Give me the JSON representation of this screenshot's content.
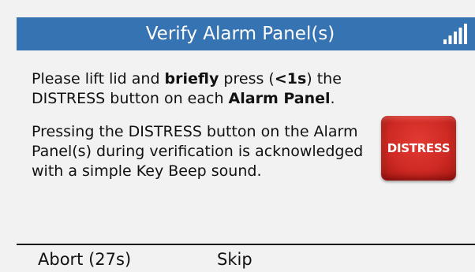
{
  "header": {
    "title": "Verify Alarm Panel(s)",
    "signal_icon": "signal-strength-icon",
    "background_color": "#3673b2"
  },
  "message": {
    "paragraph1": {
      "part1": "Please lift lid and ",
      "part2_bold": "briefly",
      "part3": " press (",
      "part4_bold": "<1s",
      "part5": ") the DISTRESS button on each ",
      "part6_bold": "Alarm Panel",
      "part7": "."
    },
    "paragraph2": "Pressing the DISTRESS button on the Alarm Panel(s) during verification is acknowledged with a simple Key Beep sound."
  },
  "distress_button": {
    "label": "DISTRESS",
    "color": "#cf2a24"
  },
  "softkeys": {
    "abort_label": "Abort (27s)",
    "skip_label": "Skip"
  }
}
